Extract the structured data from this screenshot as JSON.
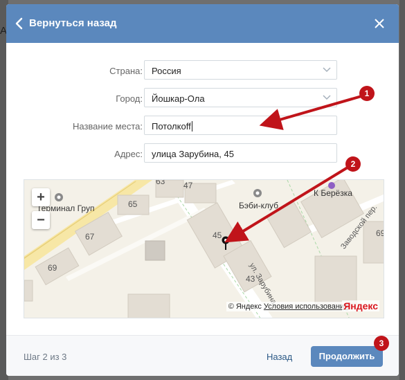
{
  "background": {
    "letter": "А"
  },
  "header": {
    "back_label": "Вернуться назад"
  },
  "form": {
    "country": {
      "label": "Страна:",
      "value": "Россия"
    },
    "city": {
      "label": "Город:",
      "value": "Йошкар-Ола"
    },
    "place_name": {
      "label": "Название места:",
      "value": "Потолкоff"
    },
    "address": {
      "label": "Адрес:",
      "value": "улица Зарубина, 45"
    }
  },
  "map": {
    "zoom_in": "+",
    "zoom_out": "−",
    "labels": {
      "poi_left": "Терминал Груп",
      "poi_bebi": "Бэби-клуб",
      "poi_bereza": "К Берёзка",
      "street_zarubina": "ул. Зарубина",
      "street_zavodskoy": "Заводской пер.",
      "house_63": "63",
      "house_47": "47",
      "house_65": "65",
      "house_67": "67",
      "house_69_left": "69",
      "house_45": "45",
      "house_43": "43",
      "house_69_right": "69"
    },
    "copyright": "© Яндекс",
    "terms_link": "Условия использования",
    "brand": "Яндекс"
  },
  "footer": {
    "step": "Шаг 2 из 3",
    "back": "Назад",
    "continue": "Продолжить"
  },
  "annotations": {
    "badge1": "1",
    "badge2": "2",
    "badge3": "3"
  },
  "colors": {
    "accent": "#5b88bd",
    "annotation_red": "#c0141a",
    "brand_red": "#d9141c"
  }
}
